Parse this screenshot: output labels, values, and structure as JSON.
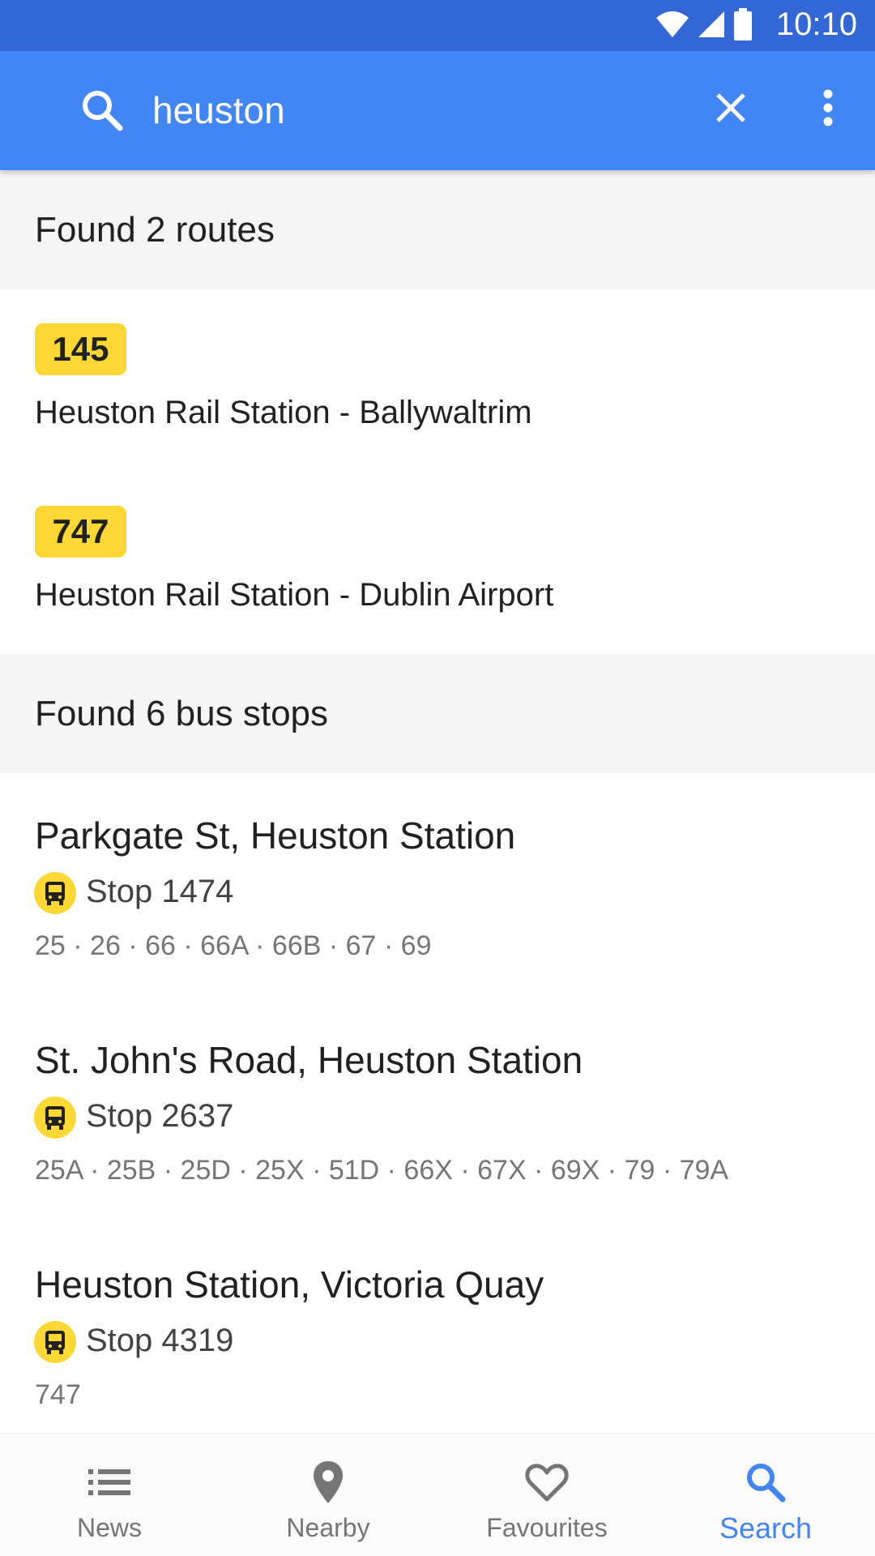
{
  "status_bar": {
    "time": "10:10",
    "icons": [
      "wifi-icon",
      "cell-signal-icon",
      "battery-icon"
    ]
  },
  "search": {
    "query": "heuston",
    "icons": {
      "search": "search-icon",
      "clear": "close-icon",
      "more": "more-vert-icon"
    }
  },
  "routes_section": {
    "header": "Found 2 routes",
    "items": [
      {
        "number": "145",
        "description": "Heuston Rail Station - Ballywaltrim"
      },
      {
        "number": "747",
        "description": "Heuston Rail Station - Dublin Airport"
      }
    ]
  },
  "stops_section": {
    "header": "Found 6 bus stops",
    "items": [
      {
        "name": "Parkgate St, Heuston Station",
        "stop": "Stop 1474",
        "routes": "25 · 26 · 66 · 66A · 66B · 67 · 69"
      },
      {
        "name": "St. John's Road, Heuston Station",
        "stop": "Stop 2637",
        "routes": "25A · 25B · 25D · 25X · 51D · 66X · 67X · 69X · 79 · 79A"
      },
      {
        "name": "Heuston Station, Victoria Quay",
        "stop": "Stop 4319",
        "routes": "747"
      }
    ]
  },
  "bottom_nav": {
    "items": [
      {
        "label": "News",
        "icon": "list-icon"
      },
      {
        "label": "Nearby",
        "icon": "location-pin-icon"
      },
      {
        "label": "Favourites",
        "icon": "heart-icon"
      },
      {
        "label": "Search",
        "icon": "search-icon"
      }
    ],
    "active": "Search"
  },
  "colors": {
    "status_bar": "#3367d6",
    "app_bar": "#4285f4",
    "badge": "#fdd835",
    "section_bg": "#f5f5f5",
    "nav_active": "#4285f4",
    "nav_inactive": "#757575"
  }
}
